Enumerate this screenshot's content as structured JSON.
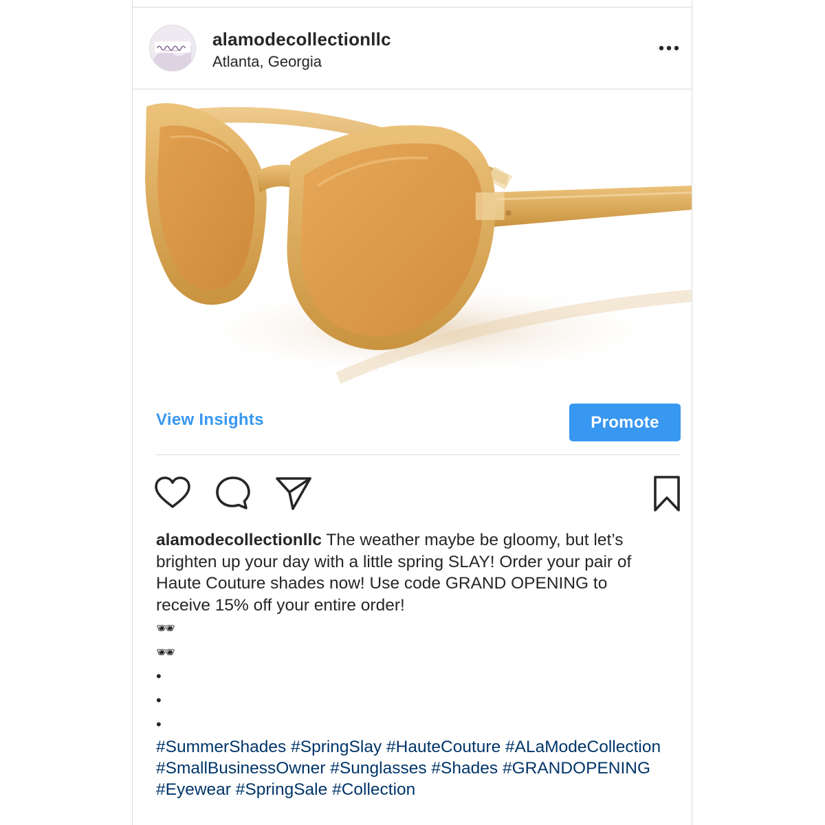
{
  "post": {
    "username": "alamodecollectionllc",
    "location": "Atlanta, Georgia",
    "avatar_icon": "brand-logo-avatar",
    "more_icon": "more-options-icon"
  },
  "insights": {
    "view_insights_label": "View Insights",
    "promote_label": "Promote",
    "accent_color": "#3897f0"
  },
  "actions": {
    "like_icon": "heart-icon",
    "comment_icon": "comment-icon",
    "share_icon": "paper-plane-icon",
    "save_icon": "bookmark-icon"
  },
  "caption": {
    "username": "alamodecollectionllc",
    "text": "The weather maybe be gloomy, but let’s brighten up your day with a little spring SLAY! Order your pair of Haute Couture shades now! Use code GRAND OPENING to receive 15% off your entire order!",
    "lines": [
      "🕶",
      "🕶",
      "•",
      "•",
      "•"
    ],
    "hashtags": [
      "#SummerShades",
      "#SpringSlay",
      "#HauteCouture",
      "#ALaModeCollection",
      "#SmallBusinessOwner",
      "#Sunglasses",
      "#Shades",
      "#GRANDOPENING",
      "#Eyewear",
      "#SpringSale",
      "#Collection"
    ],
    "hashtag_color": "#003569"
  },
  "media": {
    "subject": "cat-eye-sunglasses-image",
    "frame_color": "#d8a552",
    "lens_color": "#d9984a"
  }
}
